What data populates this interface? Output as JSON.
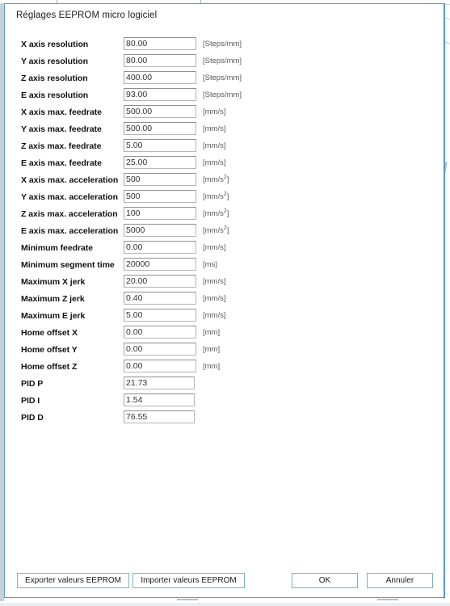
{
  "dialog": {
    "title": "Réglages EEPROM micro logiciel",
    "accent_color": "#5b9bd5",
    "button_border_color": "#7fb0bd"
  },
  "units": {
    "steps_per_mm": "[Steps/mm]",
    "mm_per_s": "[mm/s]",
    "mm_per_s2_prefix": "[mm/s",
    "mm_per_s2_exp": "2",
    "mm_per_s2_suffix": "]",
    "ms": "[ms]",
    "mm": "[mm]",
    "none": ""
  },
  "form": {
    "rows": [
      {
        "label": "X axis resolution",
        "value": "80.00",
        "unit": "[Steps/mm]",
        "unit_sup": ""
      },
      {
        "label": "Y axis resolution",
        "value": "80.00",
        "unit": "[Steps/mm]",
        "unit_sup": ""
      },
      {
        "label": "Z axis resolution",
        "value": "400.00",
        "unit": "[Steps/mm]",
        "unit_sup": ""
      },
      {
        "label": "E axis resolution",
        "value": "93.00",
        "unit": "[Steps/mm]",
        "unit_sup": ""
      },
      {
        "label": "X axis max. feedrate",
        "value": "500.00",
        "unit": "[mm/s]",
        "unit_sup": ""
      },
      {
        "label": "Y axis max. feedrate",
        "value": "500.00",
        "unit": "[mm/s]",
        "unit_sup": ""
      },
      {
        "label": "Z axis max. feedrate",
        "value": "5.00",
        "unit": "[mm/s]",
        "unit_sup": ""
      },
      {
        "label": "E axis max. feedrate",
        "value": "25.00",
        "unit": "[mm/s]",
        "unit_sup": ""
      },
      {
        "label": "X axis max. acceleration",
        "value": "500",
        "unit": "[mm/s]",
        "unit_sup": "2"
      },
      {
        "label": "Y axis max. acceleration",
        "value": "500",
        "unit": "[mm/s]",
        "unit_sup": "2"
      },
      {
        "label": "Z axis max. acceleration",
        "value": "100",
        "unit": "[mm/s]",
        "unit_sup": "2"
      },
      {
        "label": "E axis max. acceleration",
        "value": "5000",
        "unit": "[mm/s]",
        "unit_sup": "2"
      },
      {
        "label": "Minimum feedrate",
        "value": "0.00",
        "unit": "[mm/s]",
        "unit_sup": ""
      },
      {
        "label": "Minimum segment time",
        "value": "20000",
        "unit": "[ms]",
        "unit_sup": ""
      },
      {
        "label": "Maximum X jerk",
        "value": "20.00",
        "unit": "[mm/s]",
        "unit_sup": ""
      },
      {
        "label": "Maximum Z jerk",
        "value": "0.40",
        "unit": "[mm/s]",
        "unit_sup": ""
      },
      {
        "label": "Maximum E jerk",
        "value": "5.00",
        "unit": "[mm/s]",
        "unit_sup": ""
      },
      {
        "label": "Home offset X",
        "value": "0.00",
        "unit": "[mm]",
        "unit_sup": ""
      },
      {
        "label": "Home offset Y",
        "value": "0.00",
        "unit": "[mm]",
        "unit_sup": ""
      },
      {
        "label": "Home offset Z",
        "value": "0.00",
        "unit": "[mm]",
        "unit_sup": ""
      },
      {
        "label": "PID P",
        "value": "21.73",
        "unit": "",
        "unit_sup": ""
      },
      {
        "label": "PID I",
        "value": "1.54",
        "unit": "",
        "unit_sup": ""
      },
      {
        "label": "PID D",
        "value": "76.55",
        "unit": "",
        "unit_sup": ""
      }
    ]
  },
  "buttons": {
    "export": "Exporter valeurs EEPROM",
    "import": "Importer valeurs EEPROM",
    "ok": "OK",
    "cancel": "Annuler"
  }
}
